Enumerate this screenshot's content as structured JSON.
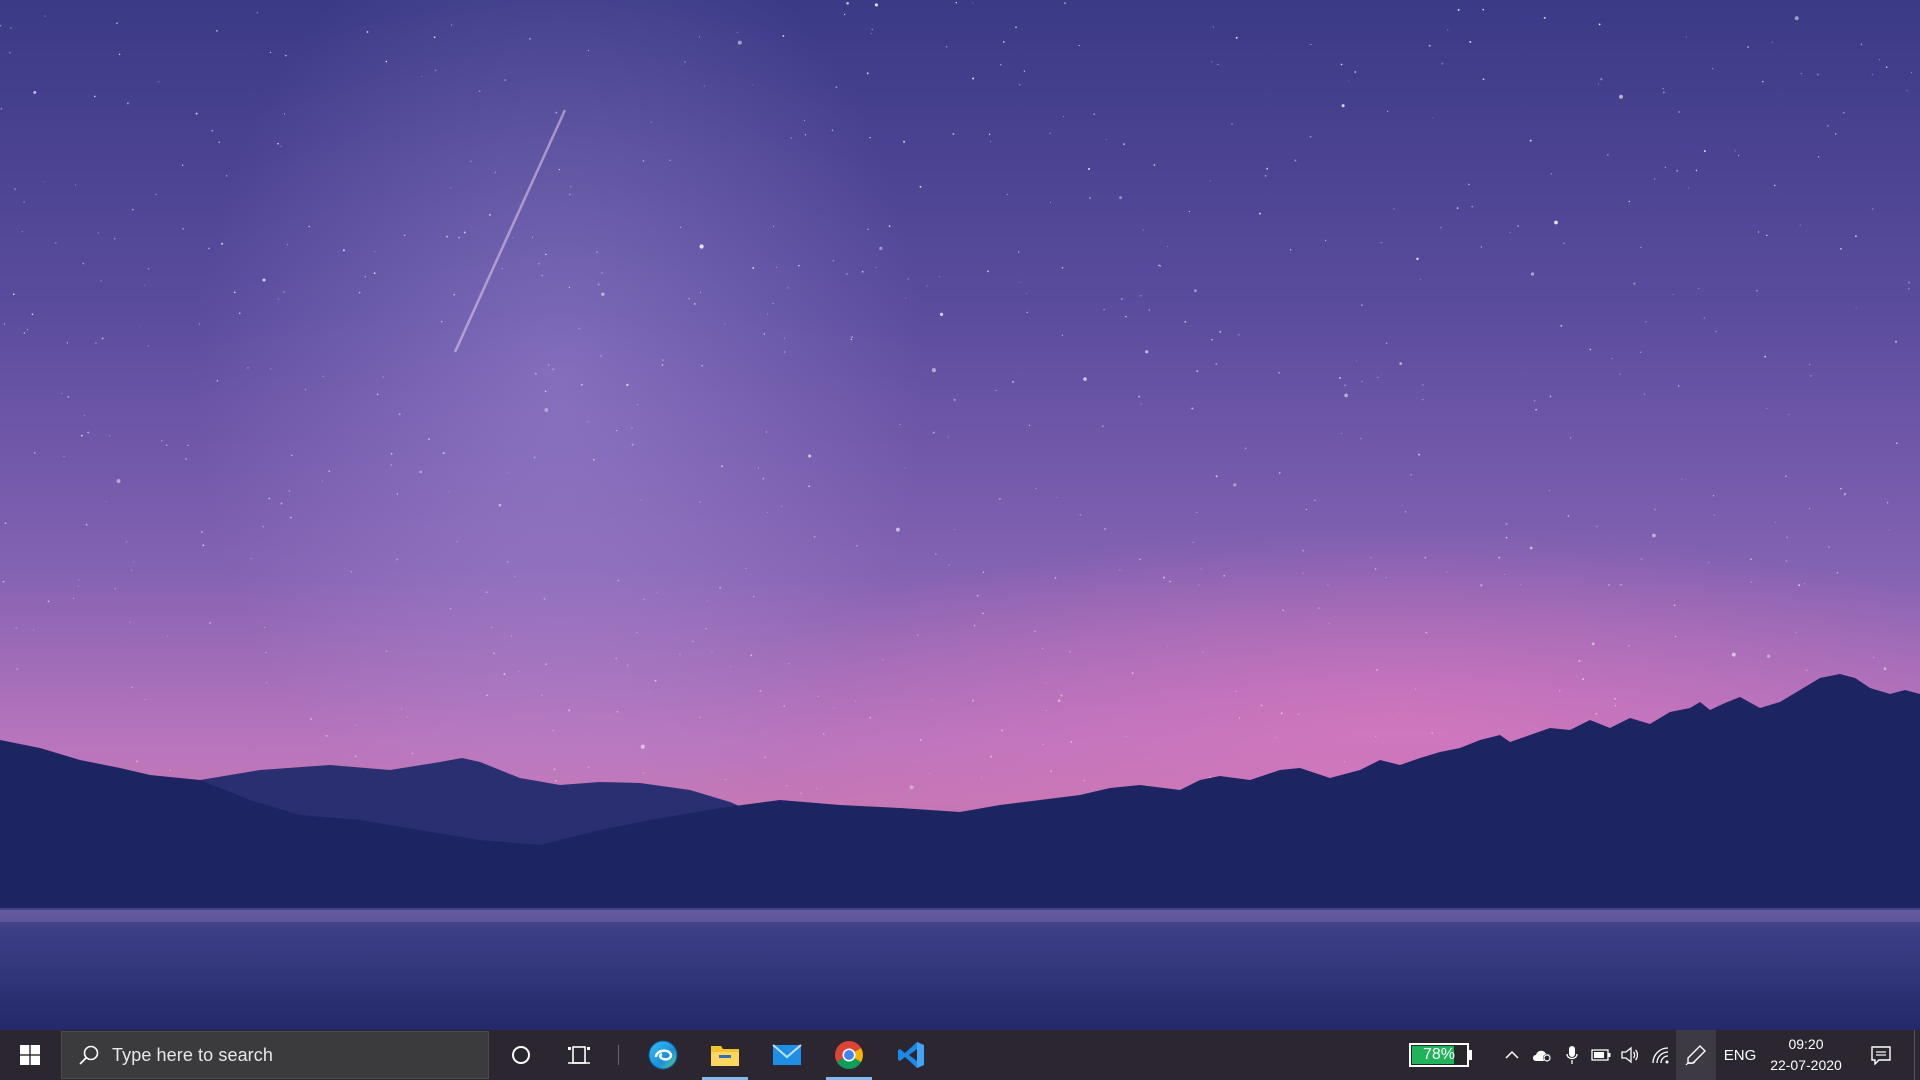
{
  "taskbar": {
    "search": {
      "placeholder": "Type here to search"
    },
    "pinned_apps": [
      {
        "name": "Microsoft Edge",
        "icon": "edge-icon",
        "open": false
      },
      {
        "name": "File Explorer",
        "icon": "folder-icon",
        "open": true
      },
      {
        "name": "Mail",
        "icon": "mail-icon",
        "open": false
      },
      {
        "name": "Google Chrome",
        "icon": "chrome-icon",
        "open": true
      },
      {
        "name": "Visual Studio Code",
        "icon": "vscode-icon",
        "open": false
      }
    ],
    "battery_widget": {
      "percent_text": "78%",
      "level": 0.78,
      "fill_color": "#1fb35a"
    },
    "tray": {
      "icons": [
        "chevron-up-icon",
        "onedrive-icon",
        "microphone-icon",
        "battery-icon",
        "volume-icon",
        "wifi-icon",
        "pen-icon"
      ],
      "language": "ENG"
    },
    "clock": {
      "time": "09:20",
      "date": "22-07-2020"
    },
    "colors": {
      "background": "#2b2630",
      "accent_underline": "#85b8ec"
    }
  }
}
